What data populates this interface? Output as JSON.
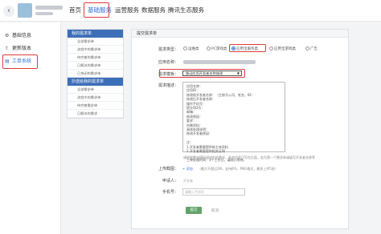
{
  "topbar": {
    "back_glyph": "‹",
    "nav": [
      {
        "label": "首页"
      },
      {
        "label": "基础服务"
      },
      {
        "label": "运营服务"
      },
      {
        "label": "数据服务"
      },
      {
        "label": "腾讯生态服务"
      }
    ],
    "active_index": 1
  },
  "sidebar": {
    "items": [
      {
        "label": "基础信息",
        "icon": "gear-icon",
        "glyph": "⚙"
      },
      {
        "label": "更新版本",
        "icon": "upload-icon",
        "glyph": "⇧"
      },
      {
        "label": "工单系统",
        "icon": "ticket-icon",
        "glyph": "▤"
      }
    ],
    "active_index": 2
  },
  "my_requests": {
    "title": "我的需求单",
    "items": [
      "全部需求单",
      "流程中的需求单",
      "待完善的需求单",
      "已解决的需求单",
      "已关闭的需求单"
    ]
  },
  "cc_requests": {
    "title": "抄送给我的需求单",
    "items": [
      "全部需求单",
      "流程中的需求单",
      "待完善需求单",
      "已解决的需求"
    ]
  },
  "form": {
    "title": "提交需求单",
    "type_label": "需求类型：",
    "type_options": [
      "运维类",
      "PC游戏类",
      "应用宝服务类",
      "应用宝游戏类",
      "广告"
    ],
    "type_selected": 2,
    "app_label": "应用名称：",
    "template_label": "需求模板：",
    "template_value": "移动应用开发者名称修改",
    "desc_label": "需求描述：",
    "desc_text": "应用名称：\n应用ID：\n修改前开发者名称：（主账号公司、姓名、ID）\n修改后开发者名称：\n操作手机号：\n提交QQ号：\n邮箱：\n修改原因：\n要求：\n所需资料：\n具体处理说明：\n修改开发者原因：\n\n注：\n1.开发者需要提供新主体资料\n2.开发者需要提供相关证明\n\n工单处理时间：3个工作日，请耐心等待。",
    "desc_hint": "请根据需求模板描述你的需求，补充信息可写在后面，若为第一个需求单请填写开发者名称等",
    "upload_label": "上传截图：",
    "upload_add": "+ 添加",
    "upload_hint": "（最大不超过2M，支持JPG、PNG格式，最多上传5张）",
    "applicant_label": "申请人：",
    "applicant_value": "开发者",
    "phone_label": "手机号：",
    "phone_placeholder": "请输入手机号",
    "submit_label": "提交",
    "cancel_label": "取消"
  },
  "colors": {
    "accent": "#2f73d8",
    "panel_header": "#3d6fb8",
    "highlight": "#e23b3b",
    "submit": "#63a36b"
  }
}
